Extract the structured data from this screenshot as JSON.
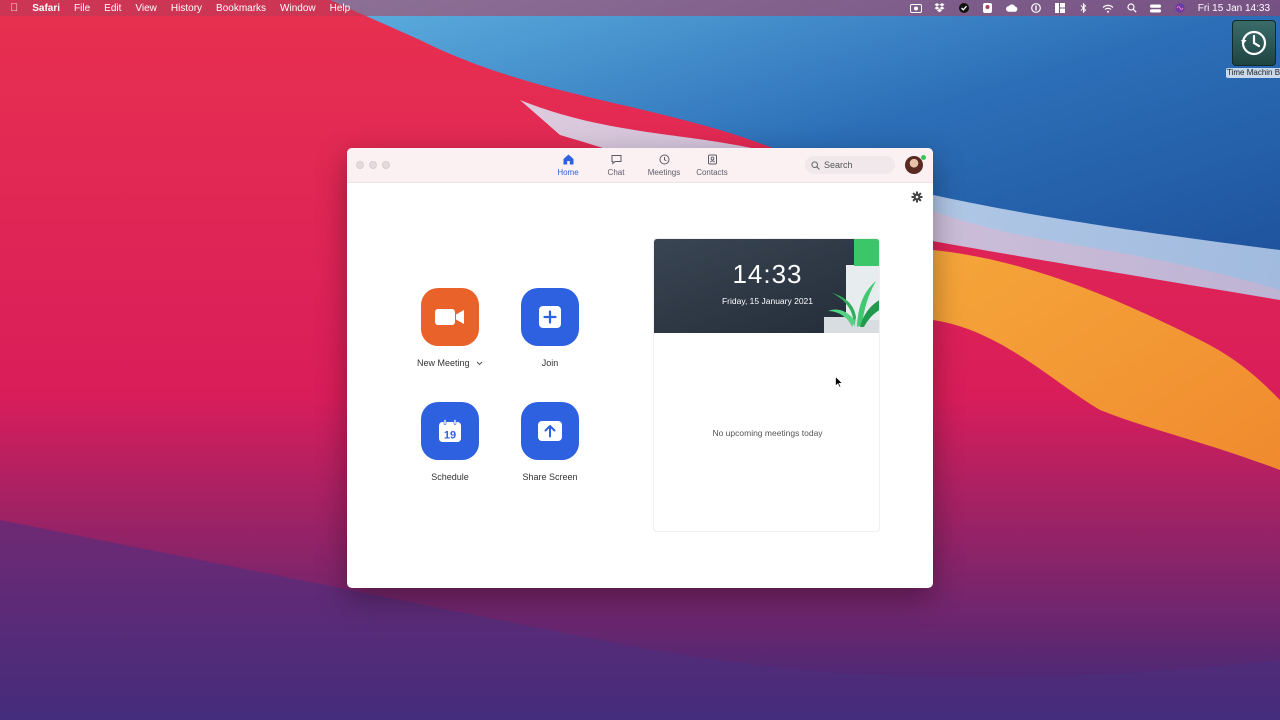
{
  "menubar": {
    "app_name": "Safari",
    "menus": [
      "File",
      "Edit",
      "View",
      "History",
      "Bookmarks",
      "Window",
      "Help"
    ],
    "clock": "Fri 15 Jan  14:33"
  },
  "desktop": {
    "time_machine_label": "Time Machin Backups"
  },
  "zoom": {
    "tabs": {
      "home": "Home",
      "chat": "Chat",
      "meetings": "Meetings",
      "contacts": "Contacts"
    },
    "active_tab": "home",
    "search_placeholder": "Search",
    "actions": {
      "new_meeting": "New Meeting",
      "join": "Join",
      "schedule": "Schedule",
      "schedule_day": "19",
      "share_screen": "Share Screen"
    },
    "panel": {
      "time": "14:33",
      "date": "Friday, 15 January 2021",
      "empty_text": "No upcoming meetings today"
    },
    "colors": {
      "accent": "#2d61e0",
      "new_meeting": "#e8622a"
    }
  }
}
